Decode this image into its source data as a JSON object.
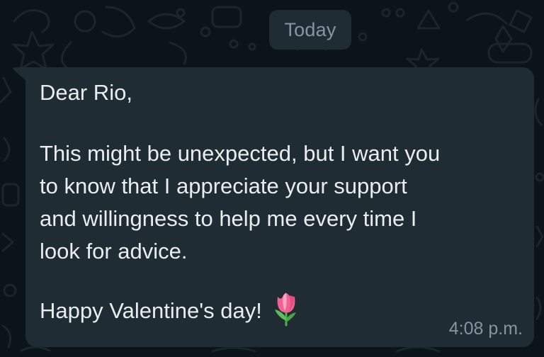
{
  "chat": {
    "date_divider": "Today",
    "message": {
      "greeting": "Dear Rio,",
      "body_lines": [
        "This might be unexpected, but I want you",
        "to know that I appreciate your support",
        "and willingness to help me every time I",
        "look for advice."
      ],
      "closing": "Happy Valentine's day!",
      "emoji": "tulip-icon",
      "timestamp": "4:08 p.m."
    }
  },
  "colors": {
    "background": "#0b141a",
    "bubble": "#1f2c33",
    "text": "#e9edef",
    "muted_text": "#8696a0"
  }
}
